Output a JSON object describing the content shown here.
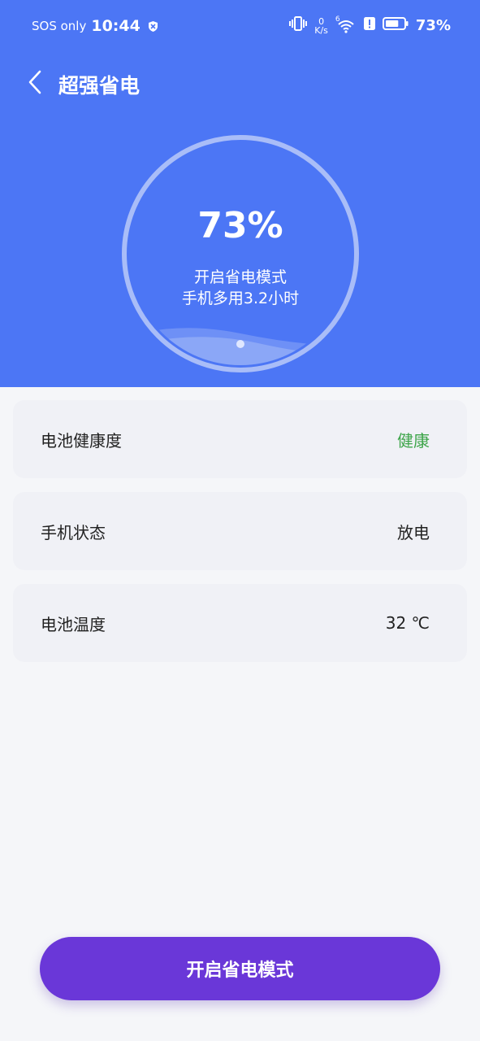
{
  "status_bar": {
    "sos": "SOS only",
    "time": "10:44",
    "net_speed_value": "0",
    "net_speed_unit": "K/s",
    "signal_tag": "6",
    "battery": "73%"
  },
  "header": {
    "title": "超强省电"
  },
  "gauge": {
    "percent": "73%",
    "line1": "开启省电模式",
    "line2": "手机多用3.2小时",
    "level": 0.73
  },
  "cards": [
    {
      "label": "电池健康度",
      "value": "健康"
    },
    {
      "label": "手机状态",
      "value": "放电"
    },
    {
      "label": "电池温度",
      "value": "32 ℃"
    }
  ],
  "cta": {
    "label": "开启省电模式"
  },
  "colors": {
    "header_bg": "#4c76f5",
    "page_bg": "#f5f6f9",
    "card_bg": "#f0f1f6",
    "healthy": "#3ea54a",
    "cta_bg": "#6a37d8"
  },
  "icons": {
    "back": "chevron-left-icon",
    "shield": "shield-icon",
    "vibrate": "vibrate-icon",
    "wifi": "wifi-icon",
    "alert": "alert-icon",
    "battery": "battery-icon"
  }
}
